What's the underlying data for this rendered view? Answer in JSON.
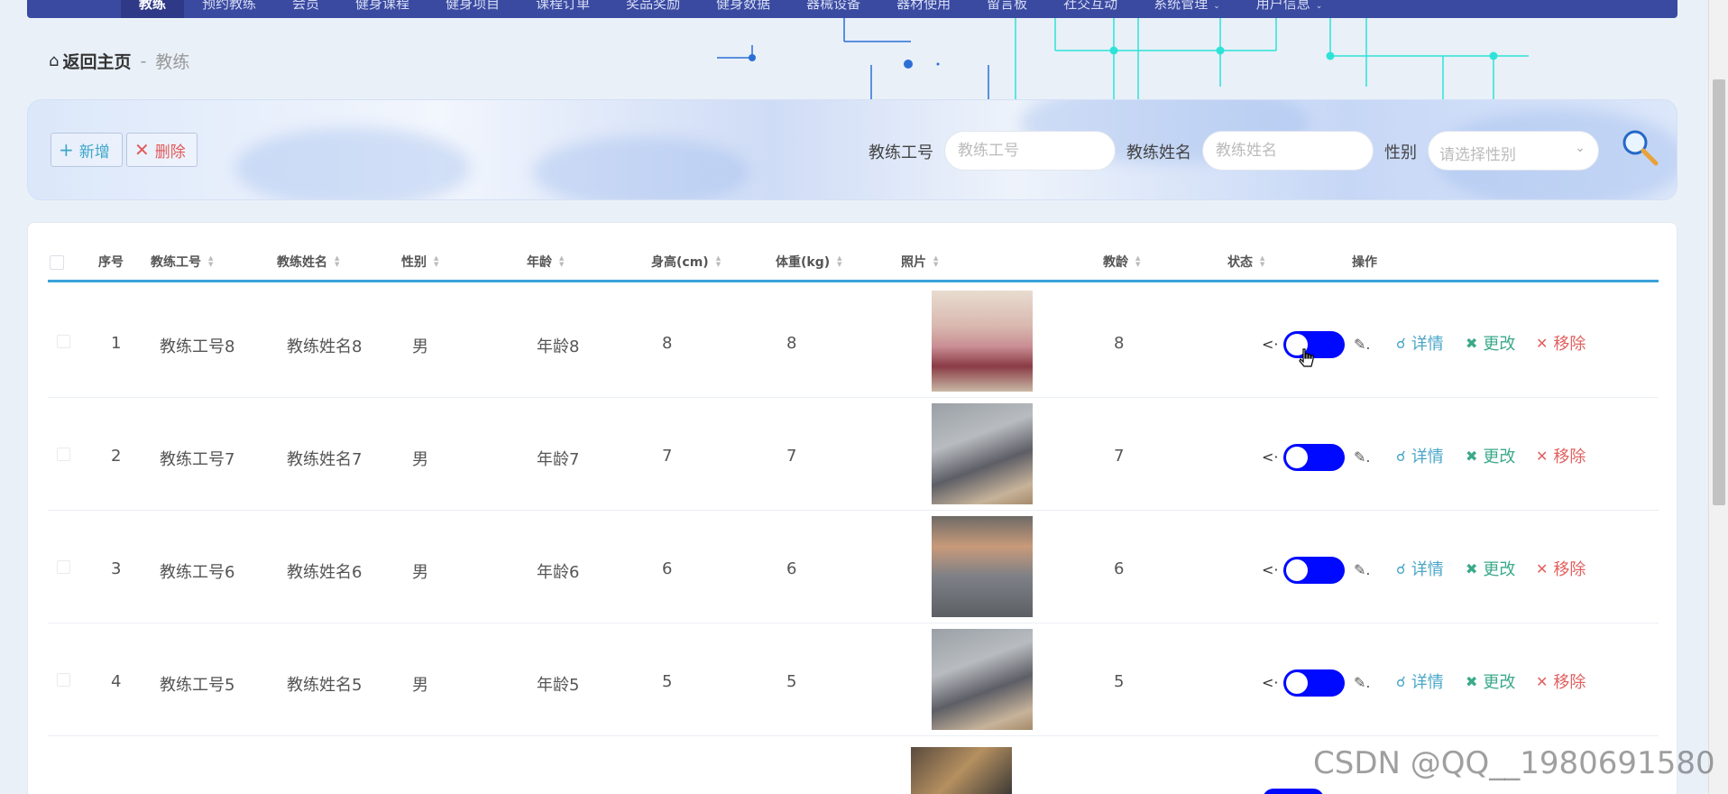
{
  "nav": {
    "items": [
      {
        "label": "教练",
        "active": true
      },
      {
        "label": "预约教练"
      },
      {
        "label": "会员"
      },
      {
        "label": "健身课程"
      },
      {
        "label": "健身项目"
      },
      {
        "label": "课程订单"
      },
      {
        "label": "奖品奖励"
      },
      {
        "label": "健身数据"
      },
      {
        "label": "器械设备"
      },
      {
        "label": "器材使用"
      },
      {
        "label": "留言板"
      },
      {
        "label": "社交互动"
      },
      {
        "label": "系统管理",
        "dropdown": true
      },
      {
        "label": "用户信息",
        "dropdown": true
      }
    ]
  },
  "breadcrumb": {
    "home": "返回主页",
    "separator": "-",
    "current": "教练"
  },
  "toolbar": {
    "add_label": "新增",
    "delete_label": "删除"
  },
  "search": {
    "coach_id_label": "教练工号",
    "coach_id_placeholder": "教练工号",
    "coach_name_label": "教练姓名",
    "coach_name_placeholder": "教练姓名",
    "gender_label": "性别",
    "gender_placeholder": "请选择性别"
  },
  "table": {
    "headers": [
      "序号",
      "教练工号",
      "教练姓名",
      "性别",
      "年龄",
      "身高(cm)",
      "体重(kg)",
      "照片",
      "教龄",
      "状态",
      "操作"
    ],
    "actions": {
      "detail": "详情",
      "edit": "更改",
      "remove": "移除"
    },
    "rows": [
      {
        "index": "1",
        "coach_id": "教练工号8",
        "name": "教练姓名8",
        "gender": "男",
        "age": "年龄8",
        "height": "8",
        "weight": "8",
        "years": "8",
        "status_on": true,
        "photo": "pink"
      },
      {
        "index": "2",
        "coach_id": "教练工号7",
        "name": "教练姓名7",
        "gender": "男",
        "age": "年龄7",
        "height": "7",
        "weight": "7",
        "years": "7",
        "status_on": true,
        "photo": "gray"
      },
      {
        "index": "3",
        "coach_id": "教练工号6",
        "name": "教练姓名6",
        "gender": "男",
        "age": "年龄6",
        "height": "6",
        "weight": "6",
        "years": "6",
        "status_on": true,
        "photo": "man"
      },
      {
        "index": "4",
        "coach_id": "教练工号5",
        "name": "教练姓名5",
        "gender": "男",
        "age": "年龄5",
        "height": "5",
        "weight": "5",
        "years": "5",
        "status_on": true,
        "photo": "gray"
      }
    ]
  },
  "watermark": "CSDN @QQ__1980691580",
  "colors": {
    "nav_bg": "#3a4aa0",
    "header_line": "#3aa2d8",
    "toggle_on": "#0009ff",
    "detail": "#49a6c8",
    "edit": "#3ba98a",
    "remove": "#e06060"
  }
}
